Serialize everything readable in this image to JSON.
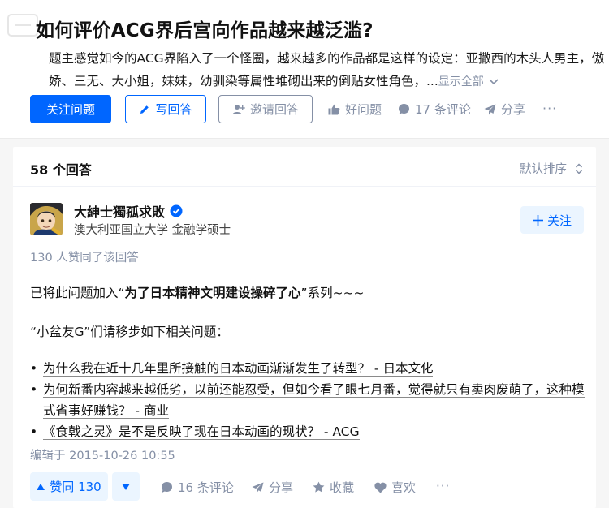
{
  "question": {
    "title": "如何评价ACG界后宫向作品越来越泛滥?",
    "detail": "题主感觉如今的ACG界陷入了一个怪圈，越来越多的作品都是这样的设定：亚撒西的木头人男主，傲娇、三无、大小姐，妹妹，幼驯染等属性堆砌出来的倒贴女性角色，...",
    "show_all": "显示全部",
    "follow_label": "关注问题",
    "write_label": "写回答",
    "invite_label": "邀请回答",
    "good_label": "好问题",
    "comments_label": "17 条评论",
    "share_label": "分享",
    "more_label": "···"
  },
  "answers": {
    "count_label": "58 个回答",
    "sort_label": "默认排序"
  },
  "answer": {
    "author_name": "大紳士獨孤求敗",
    "author_bio": "澳大利亚国立大学 金融学硕士",
    "follow_label": "关注",
    "voters_text": "130 人赞同了该回答",
    "para1_prefix": "已将此问题加入“",
    "para1_bold": "为了日本精神文明建设操碎了心",
    "para1_suffix": "”系列~~~",
    "para2": "“小盆友G”们请移步如下相关问题：",
    "links": [
      "为什么我在近十几年里所接触的日本动画渐渐发生了转型？ - 日本文化",
      "为何新番内容越来越低劣，以前还能忍受，但如今看了眼七月番，觉得就只有卖肉废萌了，这种模式省事好赚钱？ - 商业",
      "《食戟之灵》是不是反映了现在日本动画的现状？ - ACG"
    ],
    "edited": "编辑于 2015-10-26 10:55",
    "vote_label": "赞同 130",
    "comments_label": "16 条评论",
    "share_label": "分享",
    "collect_label": "收藏",
    "like_label": "喜欢",
    "more_label": "···"
  },
  "colors": {
    "brand_blue": "#0066ff",
    "muted_gray": "#8590a6",
    "light_blue_bg": "#ebf5ff"
  },
  "icons": [
    "pencil-icon",
    "add-user-icon",
    "thumb-up-icon",
    "comment-icon",
    "share-icon",
    "chevron-down-icon",
    "sort-icon",
    "verified-icon",
    "plus-icon",
    "triangle-up-icon",
    "triangle-down-icon",
    "star-icon",
    "heart-icon"
  ]
}
